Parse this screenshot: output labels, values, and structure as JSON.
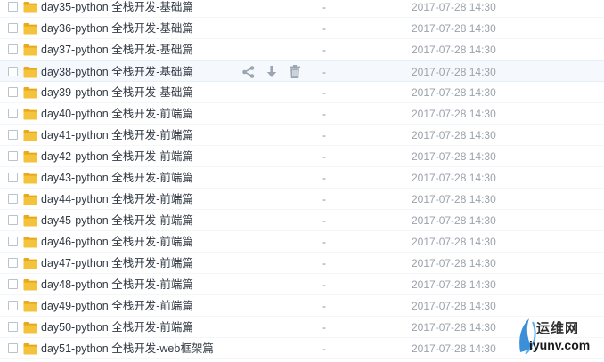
{
  "files": [
    {
      "name": "day35-python 全栈开发-基础篇",
      "size": "-",
      "date": "2017-07-28 14:30"
    },
    {
      "name": "day36-python 全栈开发-基础篇",
      "size": "-",
      "date": "2017-07-28 14:30"
    },
    {
      "name": "day37-python 全栈开发-基础篇",
      "size": "-",
      "date": "2017-07-28 14:30"
    },
    {
      "name": "day38-python 全栈开发-基础篇",
      "size": "-",
      "date": "2017-07-28 14:30"
    },
    {
      "name": "day39-python 全栈开发-基础篇",
      "size": "-",
      "date": "2017-07-28 14:30"
    },
    {
      "name": "day40-python 全栈开发-前端篇",
      "size": "-",
      "date": "2017-07-28 14:30"
    },
    {
      "name": "day41-python 全栈开发-前端篇",
      "size": "-",
      "date": "2017-07-28 14:30"
    },
    {
      "name": "day42-python 全栈开发-前端篇",
      "size": "-",
      "date": "2017-07-28 14:30"
    },
    {
      "name": "day43-python 全栈开发-前端篇",
      "size": "-",
      "date": "2017-07-28 14:30"
    },
    {
      "name": "day44-python 全栈开发-前端篇",
      "size": "-",
      "date": "2017-07-28 14:30"
    },
    {
      "name": "day45-python 全栈开发-前端篇",
      "size": "-",
      "date": "2017-07-28 14:30"
    },
    {
      "name": "day46-python 全栈开发-前端篇",
      "size": "-",
      "date": "2017-07-28 14:30"
    },
    {
      "name": "day47-python 全栈开发-前端篇",
      "size": "-",
      "date": "2017-07-28 14:30"
    },
    {
      "name": "day48-python 全栈开发-前端篇",
      "size": "-",
      "date": "2017-07-28 14:30"
    },
    {
      "name": "day49-python 全栈开发-前端篇",
      "size": "-",
      "date": "2017-07-28 14:30"
    },
    {
      "name": "day50-python 全栈开发-前端篇",
      "size": "-",
      "date": "2017-07-28 14:30"
    },
    {
      "name": "day51-python 全栈开发-web框架篇",
      "size": "-",
      "date": "2017-07-28 14:30"
    }
  ],
  "hovered_index": 3,
  "row_actions": {
    "icons": [
      "share-icon",
      "download-icon",
      "delete-icon"
    ]
  },
  "colors": {
    "folder": "#f5c23b",
    "folder_dark": "#e8a91e",
    "action_icon": "#9aa5b1",
    "hover_row": "#f5f9fd"
  },
  "watermark": {
    "text_top": "运维网",
    "text_bottom": "iyunv.com"
  }
}
